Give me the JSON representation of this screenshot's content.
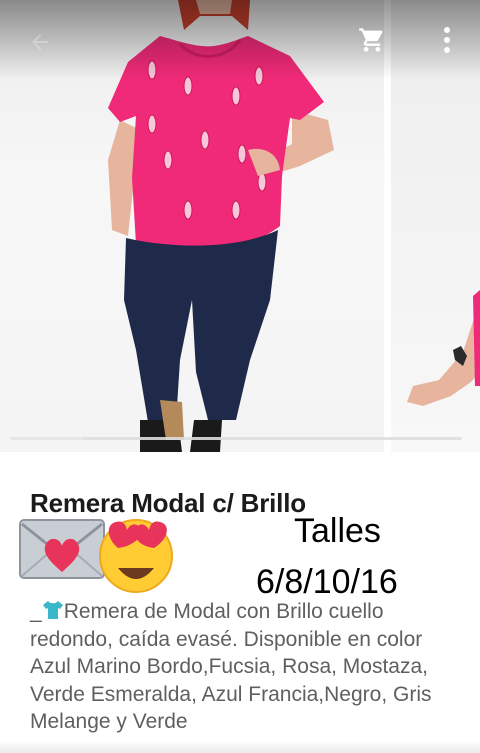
{
  "app_bar": {
    "back_icon": "arrow-back-icon",
    "cart_icon": "shopping-cart-icon",
    "more_icon": "more-vert-icon"
  },
  "carousel": {
    "slide_count": 2,
    "active_slide": 1
  },
  "product": {
    "title": "Remera Modal c/ Brillo",
    "sizes_label": "Talles",
    "sizes_values": "6/8/10/16",
    "description_prefix": "_",
    "description": "Remera de Modal con Brillo cuello redondo, caída evasé. Disponible en color Azul Marino Bordo,Fucsia, Rosa, Mostaza, Verde Esmeralda, Azul Francia,Negro, Gris Melange y Verde"
  },
  "colors": {
    "shirt": "#f02a78",
    "pants": "#1f2a4a",
    "accent_heart": "#e8335a"
  }
}
